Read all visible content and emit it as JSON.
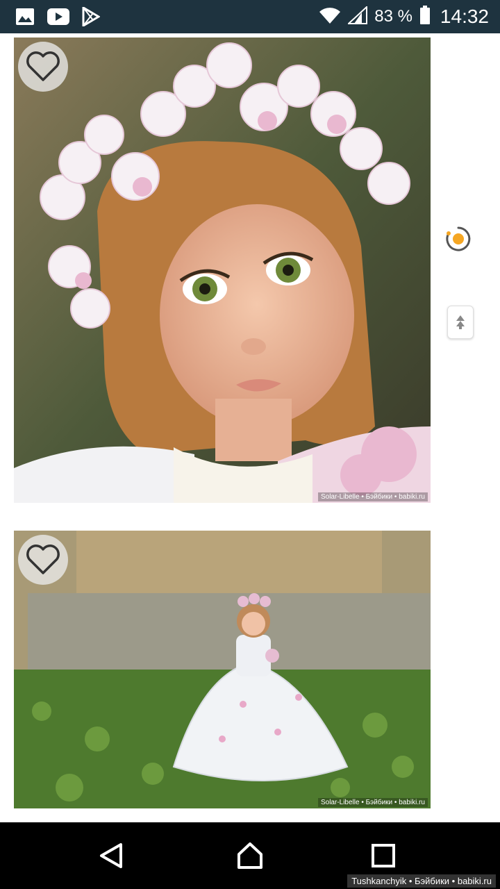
{
  "status_bar": {
    "battery_percent": "83 %",
    "time": "14:32",
    "notification_icons": [
      "image-icon",
      "youtube-icon",
      "play-store-icon"
    ],
    "system_icons": [
      "wifi-icon",
      "signal-icon",
      "battery-icon"
    ]
  },
  "feed": {
    "items": [
      {
        "watermark": "Solar-Libelle • Бэйбики • babiki.ru",
        "favorite_icon": "heart-outline-icon"
      },
      {
        "watermark": "Solar-Libelle • Бэйбики • babiki.ru",
        "favorite_icon": "heart-outline-icon"
      }
    ]
  },
  "side_controls": {
    "loading_icon": "spinner-icon",
    "scroll_top_icon": "double-chevron-up-icon"
  },
  "nav_bar": {
    "buttons": [
      "back-icon",
      "home-icon",
      "recent-apps-icon"
    ],
    "site_credit": "Tushkanchyik • Бэйбики • babiki.ru"
  },
  "colors": {
    "status_bar_bg": "#1e333f",
    "nav_bar_bg": "#000000",
    "accent_orange": "#f5a623"
  }
}
